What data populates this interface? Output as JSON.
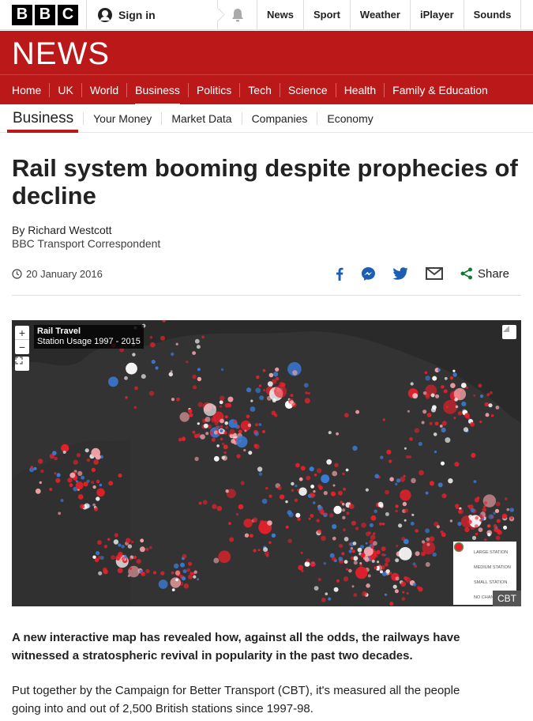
{
  "topbar": {
    "logo_letters": [
      "B",
      "B",
      "C"
    ],
    "signin_label": "Sign in",
    "nav": [
      "News",
      "Sport",
      "Weather",
      "iPlayer",
      "Sounds"
    ]
  },
  "banner": {
    "title": "NEWS"
  },
  "main_nav": {
    "items": [
      "Home",
      "UK",
      "World",
      "Business",
      "Politics",
      "Tech",
      "Science",
      "Health",
      "Family & Education"
    ],
    "active": "Business"
  },
  "sub_nav": {
    "section": "Business",
    "items": [
      "Your Money",
      "Market Data",
      "Companies",
      "Economy"
    ]
  },
  "article": {
    "headline": "Rail system booming despite prophecies of decline",
    "author": "By Richard Westcott",
    "role": "BBC Transport Correspondent",
    "date": "20 January 2016",
    "share_label": "Share",
    "intro": "A new interactive map has revealed how, against all the odds, the railways have witnessed a stratospheric revival in popularity in the past two decades.",
    "paragraph": "Put together by the Campaign for Better Transport (CBT), it's measured all the people going into and out of 2,500 British stations since 1997-98."
  },
  "map": {
    "title": "Rail Travel",
    "subtitle": "Station Usage 1997 - 2015",
    "zoom_in": "+",
    "zoom_out": "−",
    "credit": "CBT",
    "legend": [
      "Large station",
      "Medium station",
      "Small station",
      "No change"
    ],
    "colors": {
      "station_red": "#e8202a",
      "station_pink": "#f4a3a8",
      "station_blue": "#3a7bd5",
      "background": "#2a2a2a"
    }
  },
  "colors": {
    "bbc_red": "#bb1919",
    "share_blue": "#1a5fb4",
    "share_green": "#0d7a35"
  }
}
